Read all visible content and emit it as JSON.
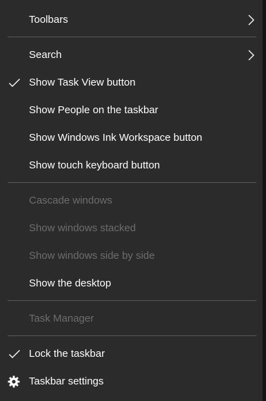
{
  "menu": {
    "toolbars": {
      "label": "Toolbars",
      "submenu_icon": "chevron-right-icon"
    },
    "search": {
      "label": "Search",
      "submenu_icon": "chevron-right-icon"
    },
    "show_task_view": {
      "label": "Show Task View button",
      "checked": true
    },
    "show_people": {
      "label": "Show People on the taskbar"
    },
    "show_ink_workspace": {
      "label": "Show Windows Ink Workspace button"
    },
    "show_touch_keyboard": {
      "label": "Show touch keyboard button"
    },
    "cascade": {
      "label": "Cascade windows",
      "disabled": true
    },
    "stacked": {
      "label": "Show windows stacked",
      "disabled": true
    },
    "side_by_side": {
      "label": "Show windows side by side",
      "disabled": true
    },
    "show_desktop": {
      "label": "Show the desktop"
    },
    "task_manager": {
      "label": "Task Manager",
      "disabled": true
    },
    "lock_taskbar": {
      "label": "Lock the taskbar",
      "checked": true
    },
    "taskbar_settings": {
      "label": "Taskbar settings",
      "icon": "gear-icon"
    }
  },
  "colors": {
    "background": "#2b2b2b",
    "text": "#ffffff",
    "disabled_text": "#6d6d6d",
    "separator": "#5a5a5a"
  }
}
